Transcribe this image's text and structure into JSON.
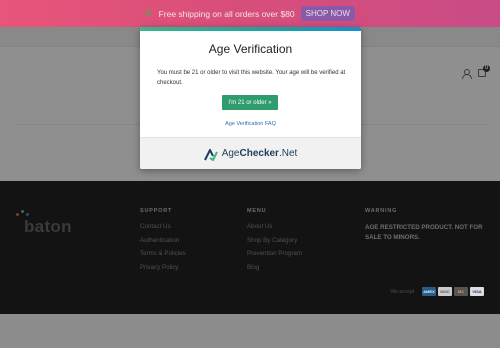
{
  "announcement": {
    "leaf_icon": "leaf-icon",
    "message": "Free shipping on all orders over $80",
    "cta": "SHOP NOW"
  },
  "header": {
    "icons": [
      "user-icon",
      "cart-icon"
    ],
    "cart_count": "0"
  },
  "modal": {
    "title": "Age Verification",
    "body": "You must be 21 or older to visit this website. Your age will be verified at checkout.",
    "confirm_button": "I'm 21 or older »",
    "faq_link": "Age Verification FAQ",
    "brand_prefix": "Age",
    "brand_bold": "Checker",
    "brand_suffix": ".Net"
  },
  "footer": {
    "brand": "baton",
    "columns": [
      {
        "title": "SUPPORT",
        "links": [
          "Contact Us",
          "Authentication",
          "Terms & Policies",
          "Privacy Policy"
        ]
      },
      {
        "title": "MENU",
        "links": [
          "About Us",
          "Shop By Category",
          "Prevention Program",
          "Blog"
        ]
      }
    ],
    "warning": {
      "title": "WARNING",
      "text": "AGE RESTRICTED PRODUCT. NOT FOR SALE TO MINORS."
    },
    "payments": {
      "label": "We accept",
      "cards": [
        "AMEX",
        "DISC",
        "MC",
        "VISA"
      ]
    }
  },
  "colors": {
    "announce_bg": "#e8557a",
    "shop_now_bg": "#8b5aa6",
    "footer_bg": "#131313",
    "confirm_green": "#2f9c6e",
    "link_blue": "#2f6fb0"
  }
}
